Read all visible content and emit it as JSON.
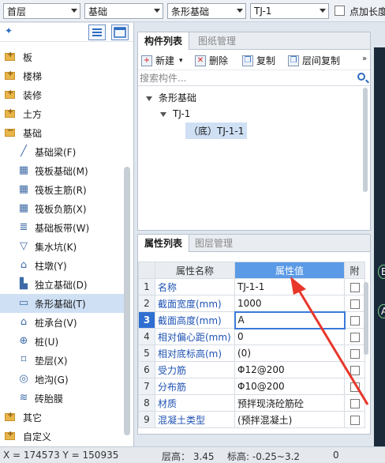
{
  "topbar": {
    "floor": "首层",
    "category": "基础",
    "type": "条形基础",
    "member": "TJ-1",
    "checkbox_label": "点加长度"
  },
  "sidebar": {
    "items": [
      {
        "label": "板",
        "kind": "folder"
      },
      {
        "label": "楼梯",
        "kind": "folder"
      },
      {
        "label": "装修",
        "kind": "folder"
      },
      {
        "label": "土方",
        "kind": "folder"
      },
      {
        "label": "基础",
        "kind": "folder-open"
      },
      {
        "label": "基础梁(F)",
        "kind": "child"
      },
      {
        "label": "筏板基础(M)",
        "kind": "child"
      },
      {
        "label": "筏板主筋(R)",
        "kind": "child"
      },
      {
        "label": "筏板负筋(X)",
        "kind": "child"
      },
      {
        "label": "基础板带(W)",
        "kind": "child"
      },
      {
        "label": "集水坑(K)",
        "kind": "child"
      },
      {
        "label": "柱墩(Y)",
        "kind": "child"
      },
      {
        "label": "独立基础(D)",
        "kind": "child"
      },
      {
        "label": "条形基础(T)",
        "kind": "child",
        "selected": true
      },
      {
        "label": "桩承台(V)",
        "kind": "child"
      },
      {
        "label": "桩(U)",
        "kind": "child"
      },
      {
        "label": "垫层(X)",
        "kind": "child"
      },
      {
        "label": "地沟(G)",
        "kind": "child"
      },
      {
        "label": "砖胎膜",
        "kind": "child"
      },
      {
        "label": "其它",
        "kind": "folder"
      },
      {
        "label": "自定义",
        "kind": "folder"
      }
    ]
  },
  "component_panel": {
    "tabs": [
      "构件列表",
      "图纸管理"
    ],
    "toolbar": {
      "new": "新建",
      "delete": "删除",
      "copy": "复制",
      "floor_copy": "层间复制"
    },
    "search_placeholder": "搜索构件...",
    "tree": {
      "root": "条形基础",
      "child": "TJ-1",
      "leaf": "（底）TJ-1-1"
    }
  },
  "property_panel": {
    "tabs": [
      "属性列表",
      "图层管理"
    ],
    "headers": {
      "name": "属性名称",
      "value": "属性值",
      "extra": "附"
    },
    "rows": [
      {
        "n": "1",
        "name": "名称",
        "value": "TJ-1-1"
      },
      {
        "n": "2",
        "name": "截面宽度(mm)",
        "value": "1000"
      },
      {
        "n": "3",
        "name": "截面高度(mm)",
        "value": "A"
      },
      {
        "n": "4",
        "name": "相对偏心距(mm)",
        "value": "0"
      },
      {
        "n": "5",
        "name": "相对底标高(m)",
        "value": "(0)"
      },
      {
        "n": "6",
        "name": "受力筋",
        "value": "Φ12@200"
      },
      {
        "n": "7",
        "name": "分布筋",
        "value": "Φ10@200"
      },
      {
        "n": "8",
        "name": "材质",
        "value": "预拌现浇砼筋砼"
      },
      {
        "n": "9",
        "name": "混凝土类型",
        "value": "(预拌混凝土)"
      }
    ]
  },
  "status": {
    "coords": "X = 174573 Y = 150935",
    "floor_height": "层高： 3.45",
    "elevation": "标高: -0.25~3.2",
    "zero": "0"
  },
  "colors": {
    "accent": "#5a9ae6",
    "selection": "#cfe0f5",
    "arrow": "#e8362a"
  }
}
